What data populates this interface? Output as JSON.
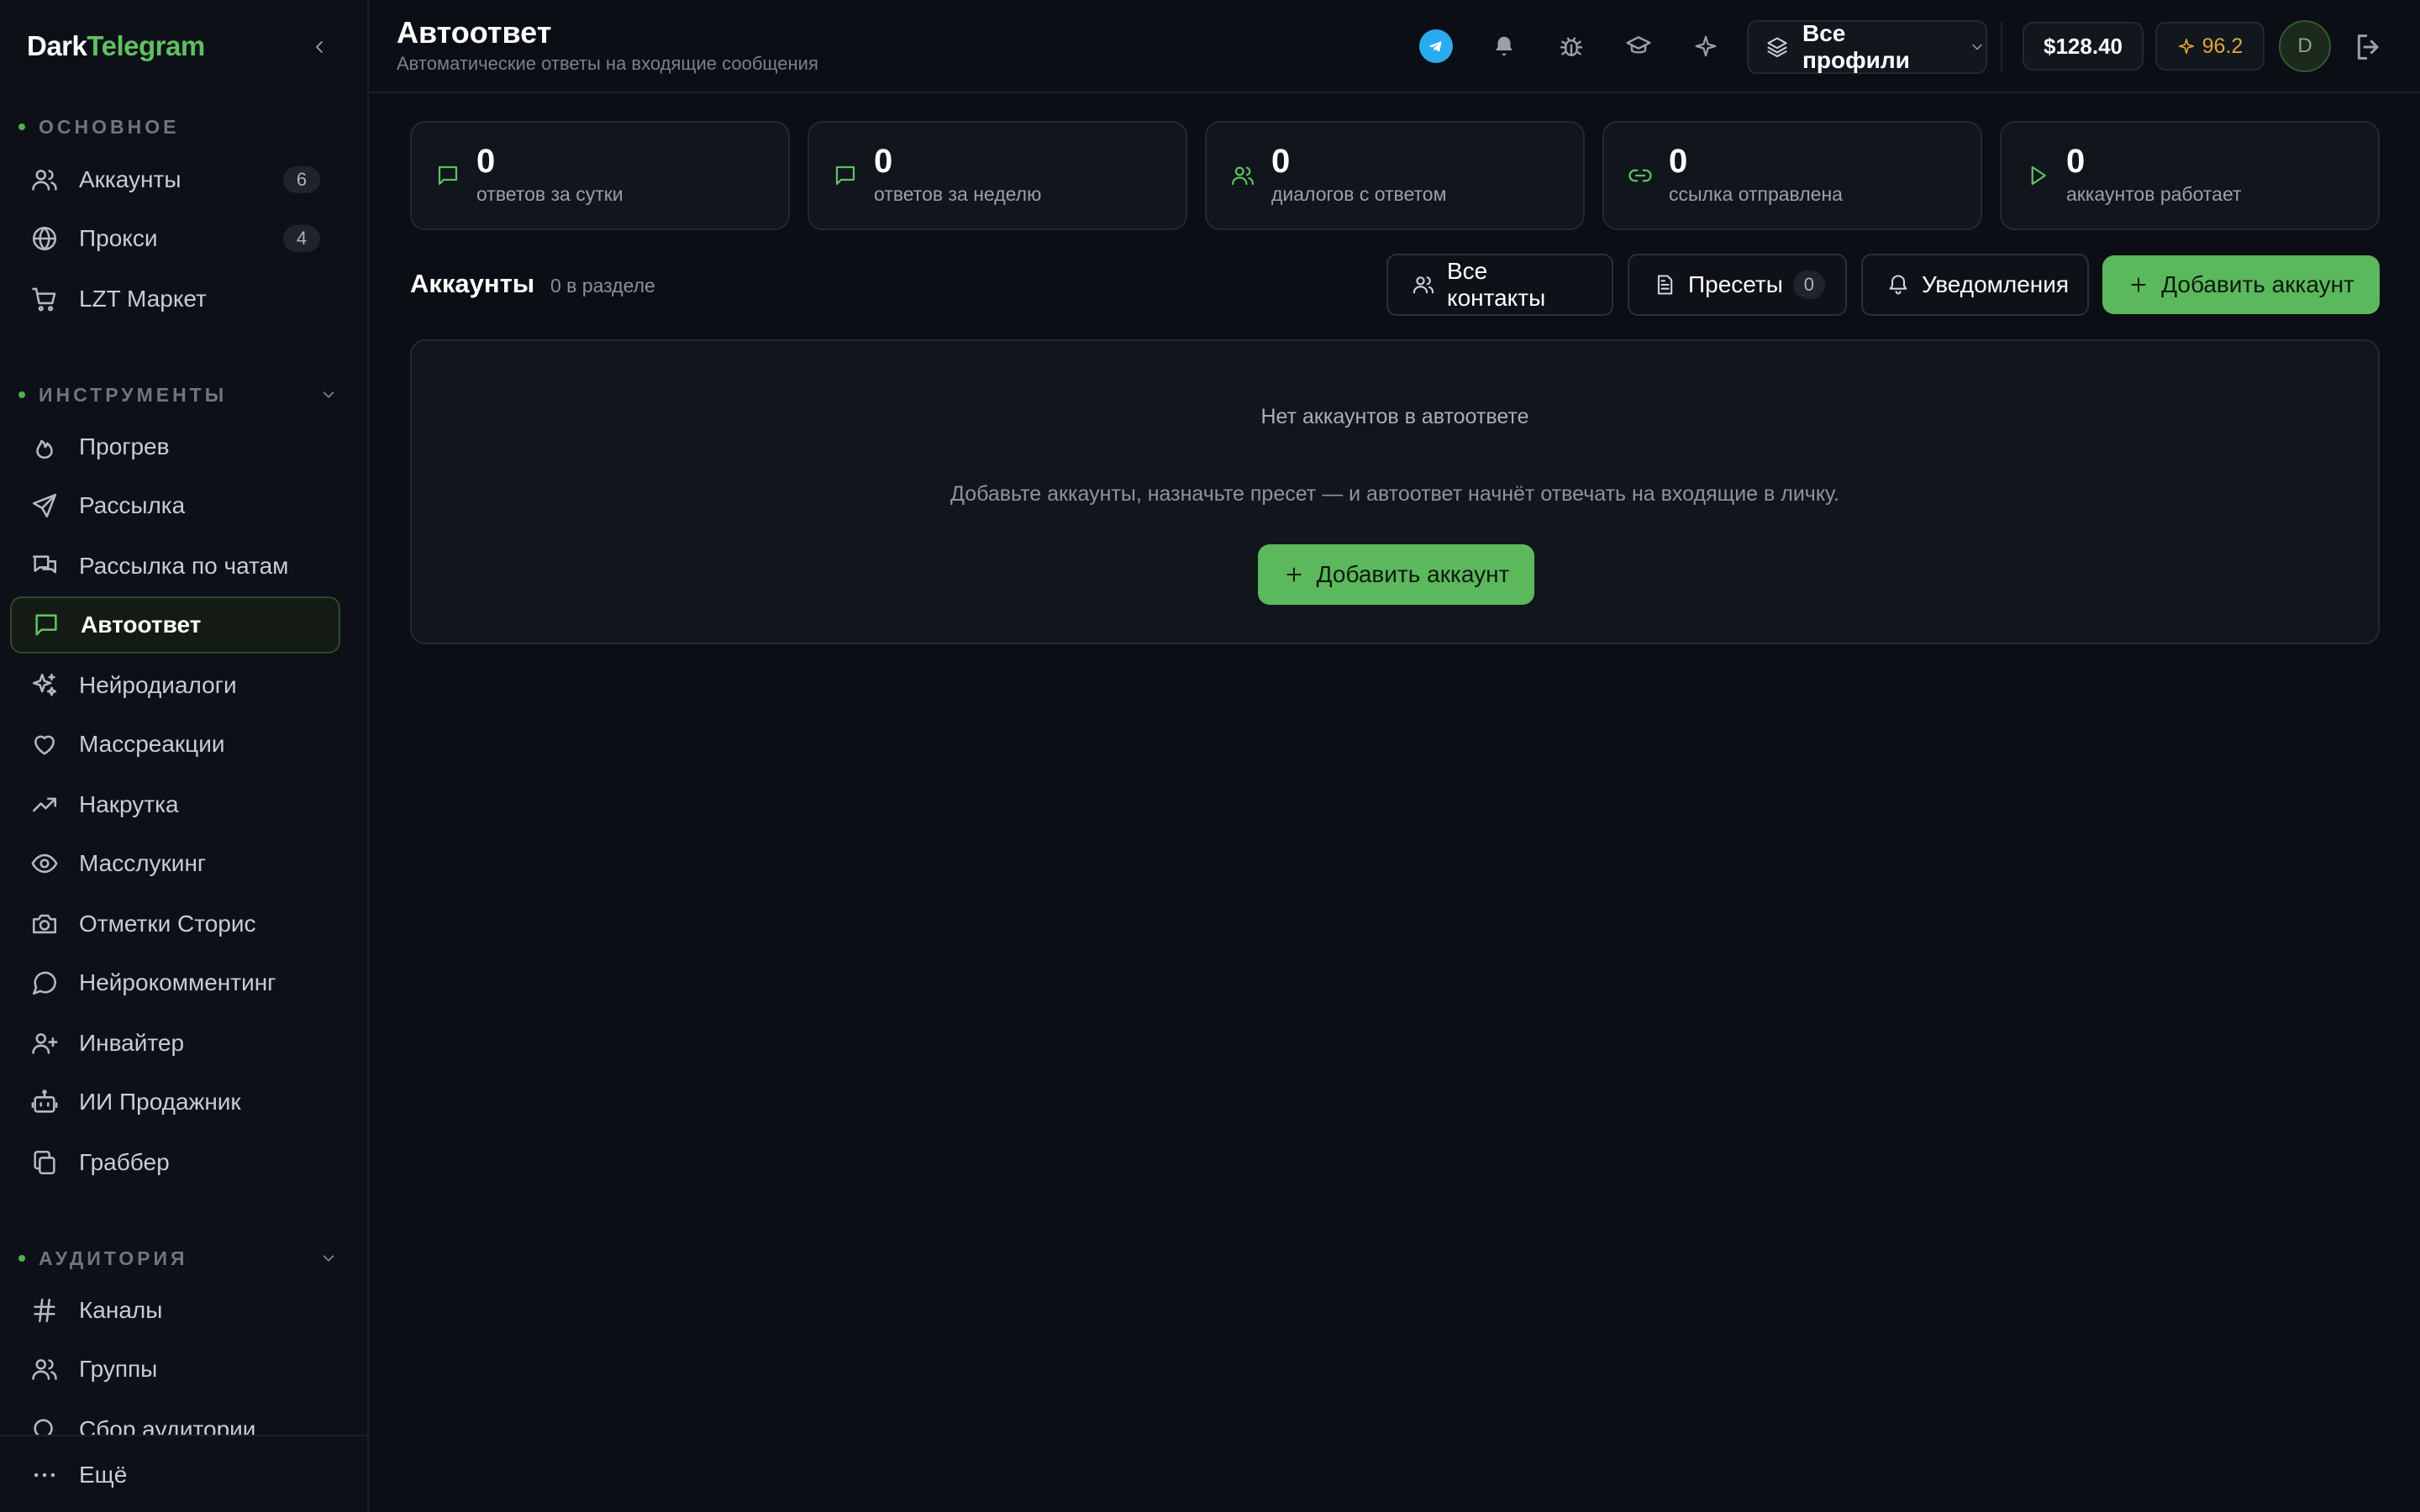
{
  "brand": {
    "part1": "Dark",
    "part2": "Telegram"
  },
  "sidebar": {
    "sections": [
      {
        "title": "ОСНОВНОЕ"
      },
      {
        "title": "ИНСТРУМЕНТЫ"
      },
      {
        "title": "АУДИТОРИЯ"
      }
    ],
    "main_items": [
      {
        "label": "Аккаунты",
        "icon": "users-icon",
        "badge": "6"
      },
      {
        "label": "Прокси",
        "icon": "globe-icon",
        "badge": "4"
      },
      {
        "label": "LZT Маркет",
        "icon": "cart-icon"
      }
    ],
    "tool_items": [
      {
        "label": "Прогрев",
        "icon": "flame-icon"
      },
      {
        "label": "Рассылка",
        "icon": "send-icon"
      },
      {
        "label": "Рассылка по чатам",
        "icon": "chats-icon"
      },
      {
        "label": "Автоответ",
        "icon": "message-square-icon",
        "active": true
      },
      {
        "label": "Нейродиалоги",
        "icon": "sparkles-icon"
      },
      {
        "label": "Массреакции",
        "icon": "heart-icon"
      },
      {
        "label": "Накрутка",
        "icon": "trending-up-icon"
      },
      {
        "label": "Масслукинг",
        "icon": "eye-icon"
      },
      {
        "label": "Отметки Сторис",
        "icon": "camera-icon"
      },
      {
        "label": "Нейрокомментинг",
        "icon": "message-circle-icon"
      },
      {
        "label": "Инвайтер",
        "icon": "user-plus-icon"
      },
      {
        "label": "ИИ Продажник",
        "icon": "bot-icon"
      },
      {
        "label": "Граббер",
        "icon": "copy-icon"
      }
    ],
    "audience_items": [
      {
        "label": "Каналы",
        "icon": "hash-icon"
      },
      {
        "label": "Группы",
        "icon": "users-icon"
      },
      {
        "label": "Сбор аудитории",
        "icon": "search-icon"
      }
    ],
    "more_label": "Ещё"
  },
  "header": {
    "title": "Автоответ",
    "subtitle": "Автоматические ответы на входящие сообщения",
    "profile_select": "Все профили",
    "balance": "$128.40",
    "rating": "96.2",
    "avatar_letter": "D"
  },
  "stats": [
    {
      "value": "0",
      "label": "ответов за сутки",
      "icon": "message-square-icon"
    },
    {
      "value": "0",
      "label": "ответов за неделю",
      "icon": "message-square-icon"
    },
    {
      "value": "0",
      "label": "диалогов с ответом",
      "icon": "users-icon"
    },
    {
      "value": "0",
      "label": "ссылка отправлена",
      "icon": "link-icon"
    },
    {
      "value": "0",
      "label": "аккаунтов работает",
      "icon": "play-icon"
    }
  ],
  "section": {
    "title": "Аккаунты",
    "count_text": "0 в разделе",
    "buttons": {
      "contacts": "Все контакты",
      "presets": "Пресеты",
      "presets_count": "0",
      "notifications": "Уведомления",
      "add": "Добавить аккаунт"
    }
  },
  "empty": {
    "title": "Нет аккаунтов в автоответе",
    "description": "Добавьте аккаунты, назначьте пресет — и автоответ начнёт отвечать на входящие в личку.",
    "button": "Добавить аккаунт"
  },
  "colors": {
    "accent": "#5cb85c",
    "background": "#0b0e14",
    "panel": "#11151c",
    "rating": "#e0a63a"
  }
}
